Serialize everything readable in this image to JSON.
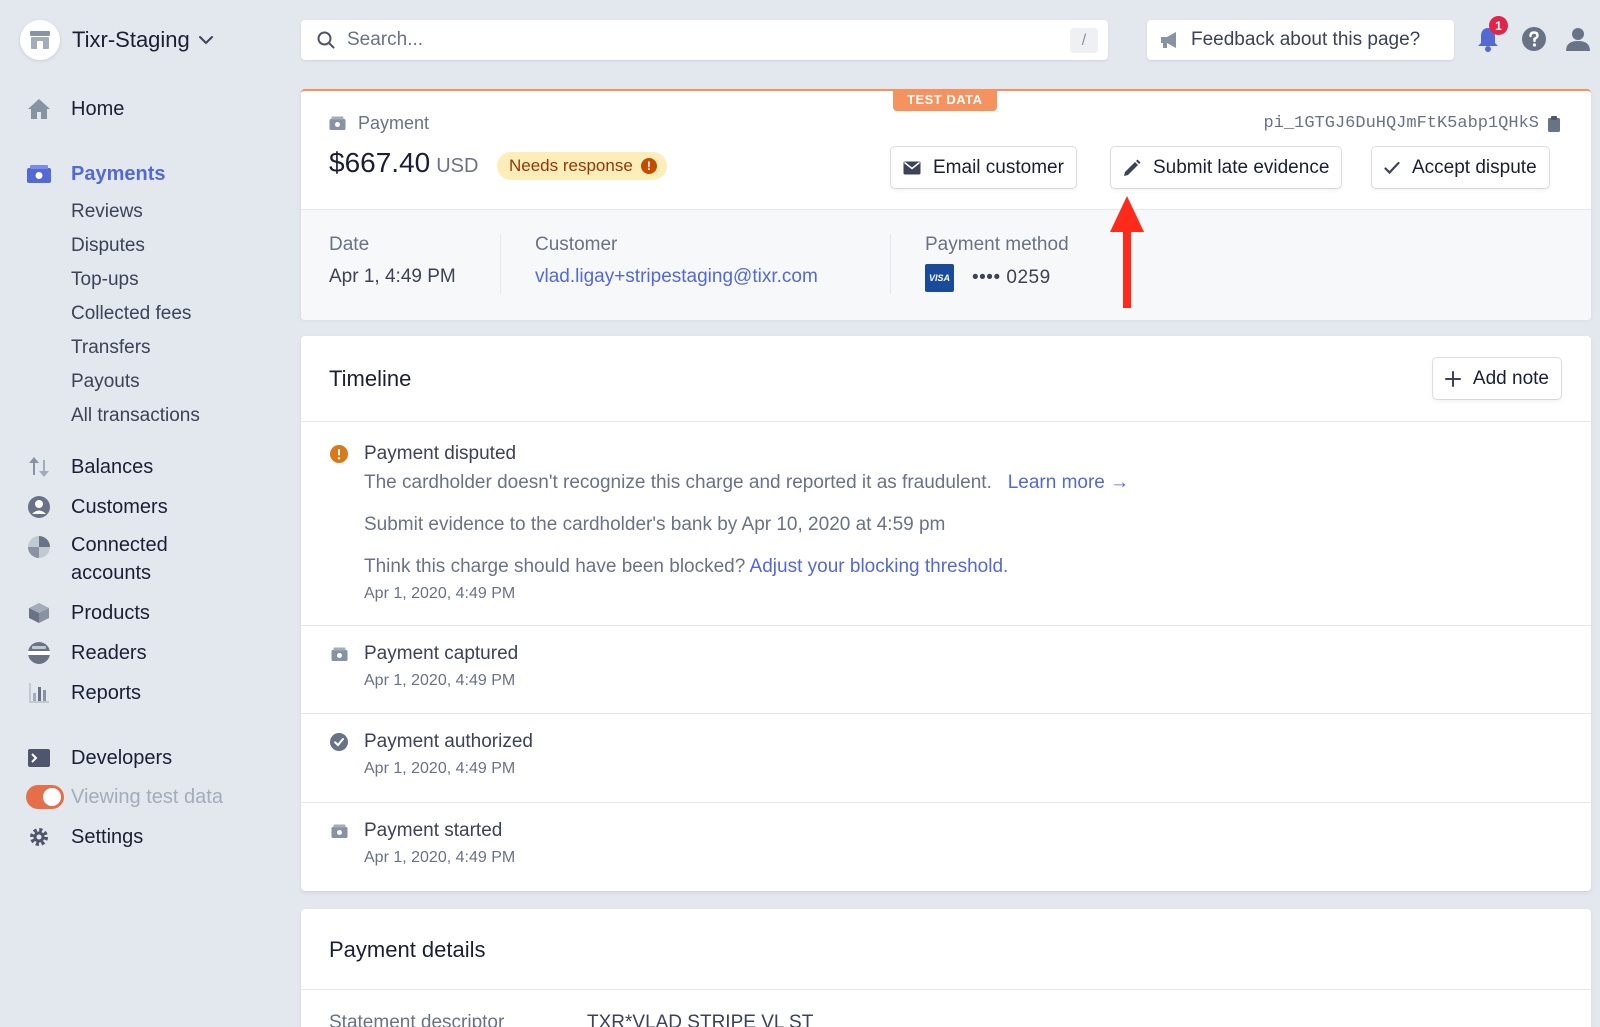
{
  "account": {
    "name": "Tixr-Staging"
  },
  "search": {
    "placeholder": "Search...",
    "shortcut": "/"
  },
  "feedback": {
    "label": "Feedback about this page?"
  },
  "notifications": {
    "count": "1"
  },
  "sidebar": {
    "home": "Home",
    "payments": "Payments",
    "payments_sub": [
      "Reviews",
      "Disputes",
      "Top-ups",
      "Collected fees",
      "Transfers",
      "Payouts",
      "All transactions"
    ],
    "balances": "Balances",
    "customers": "Customers",
    "connected_accounts": "Connected accounts",
    "products": "Products",
    "readers": "Readers",
    "reports": "Reports",
    "developers": "Developers",
    "test_data": "Viewing test data",
    "settings": "Settings"
  },
  "payment": {
    "test_badge": "TEST DATA",
    "label": "Payment",
    "id": "pi_1GTGJ6DuHQJmFtK5abp1QHkS",
    "amount": "$667.40",
    "currency": "USD",
    "status": "Needs response",
    "actions": {
      "email": "Email customer",
      "evidence": "Submit late evidence",
      "accept": "Accept dispute"
    },
    "meta": {
      "date_label": "Date",
      "date_value": "Apr 1, 4:49 PM",
      "customer_label": "Customer",
      "customer_value": "vlad.ligay+stripestaging@tixr.com",
      "method_label": "Payment method",
      "card_brand": "VISA",
      "card_last4": "•••• 0259"
    }
  },
  "timeline": {
    "title": "Timeline",
    "add_note": "Add note",
    "disputed": {
      "title": "Payment disputed",
      "desc": "The cardholder doesn't recognize this charge and reported it as fraudulent.",
      "learn_more": "Learn more →",
      "deadline": "Submit evidence to the cardholder's bank by Apr 10, 2020 at 4:59 pm",
      "blocked_q": "Think this charge should have been blocked?",
      "blocked_link": "Adjust your blocking threshold.",
      "date": "Apr 1, 2020, 4:49 PM"
    },
    "events": [
      {
        "title": "Payment captured",
        "date": "Apr 1, 2020, 4:49 PM"
      },
      {
        "title": "Payment authorized",
        "date": "Apr 1, 2020, 4:49 PM"
      },
      {
        "title": "Payment started",
        "date": "Apr 1, 2020, 4:49 PM"
      }
    ]
  },
  "details": {
    "title": "Payment details",
    "statement_label": "Statement descriptor",
    "statement_value": "TXR*VLAD STRIPE VL ST"
  },
  "colors": {
    "accent": "#5469d4",
    "test_orange": "#f5925e",
    "warning": "#c44c00",
    "arrow": "#ff2a1a"
  }
}
